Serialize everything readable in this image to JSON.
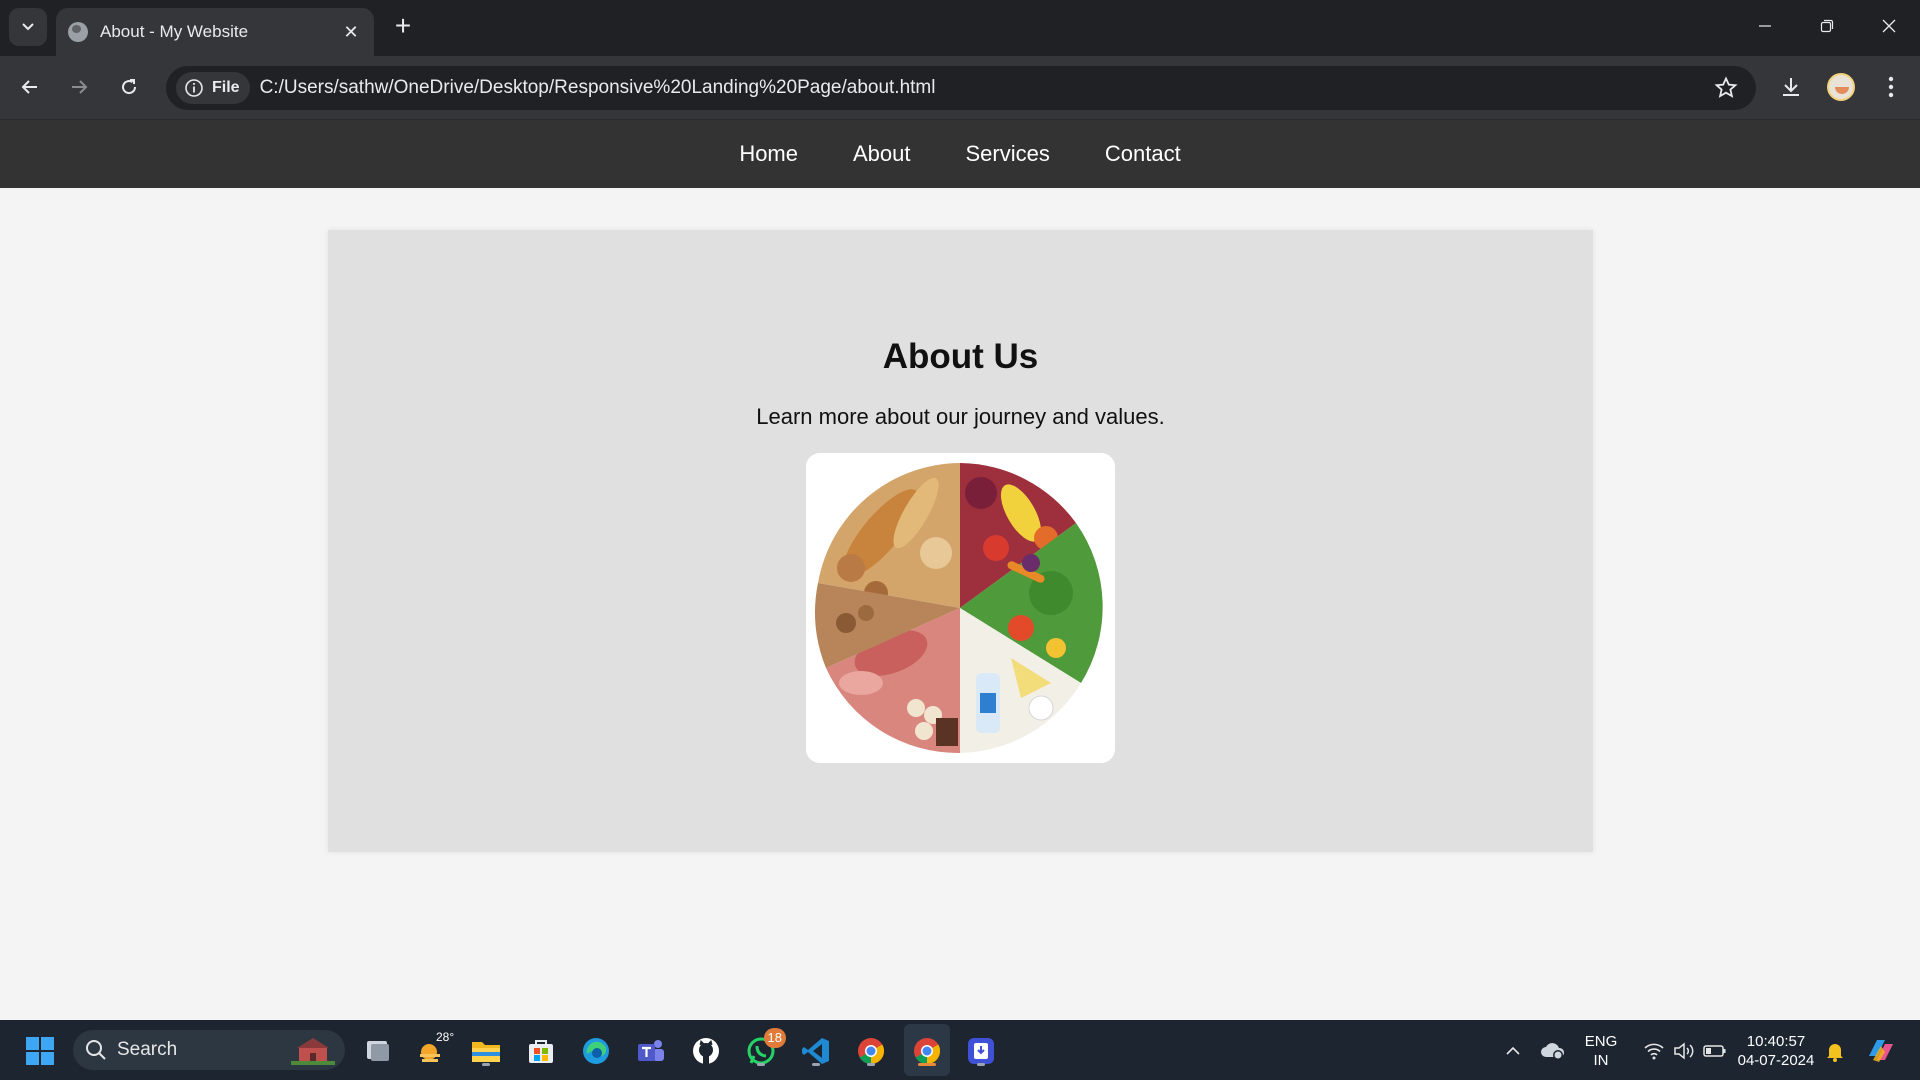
{
  "browser": {
    "tab_title": "About - My Website",
    "address_chip": "File",
    "url": "C:/Users/sathw/OneDrive/Desktop/Responsive%20Landing%20Page/about.html"
  },
  "site": {
    "nav": [
      "Home",
      "About",
      "Services",
      "Contact"
    ],
    "about": {
      "title": "About Us",
      "subtitle": "Learn more about our journey and values."
    }
  },
  "taskbar": {
    "search_label": "Search",
    "weather_temp": "28°",
    "whatsapp_badge": "18",
    "language": "ENG",
    "region": "IN",
    "time": "10:40:57",
    "date": "04-07-2024"
  },
  "colors": {
    "nav_bg": "#333333",
    "card_bg": "#e0e0e0",
    "page_bg": "#f4f4f4",
    "taskbar_bg": "#1c2530"
  }
}
